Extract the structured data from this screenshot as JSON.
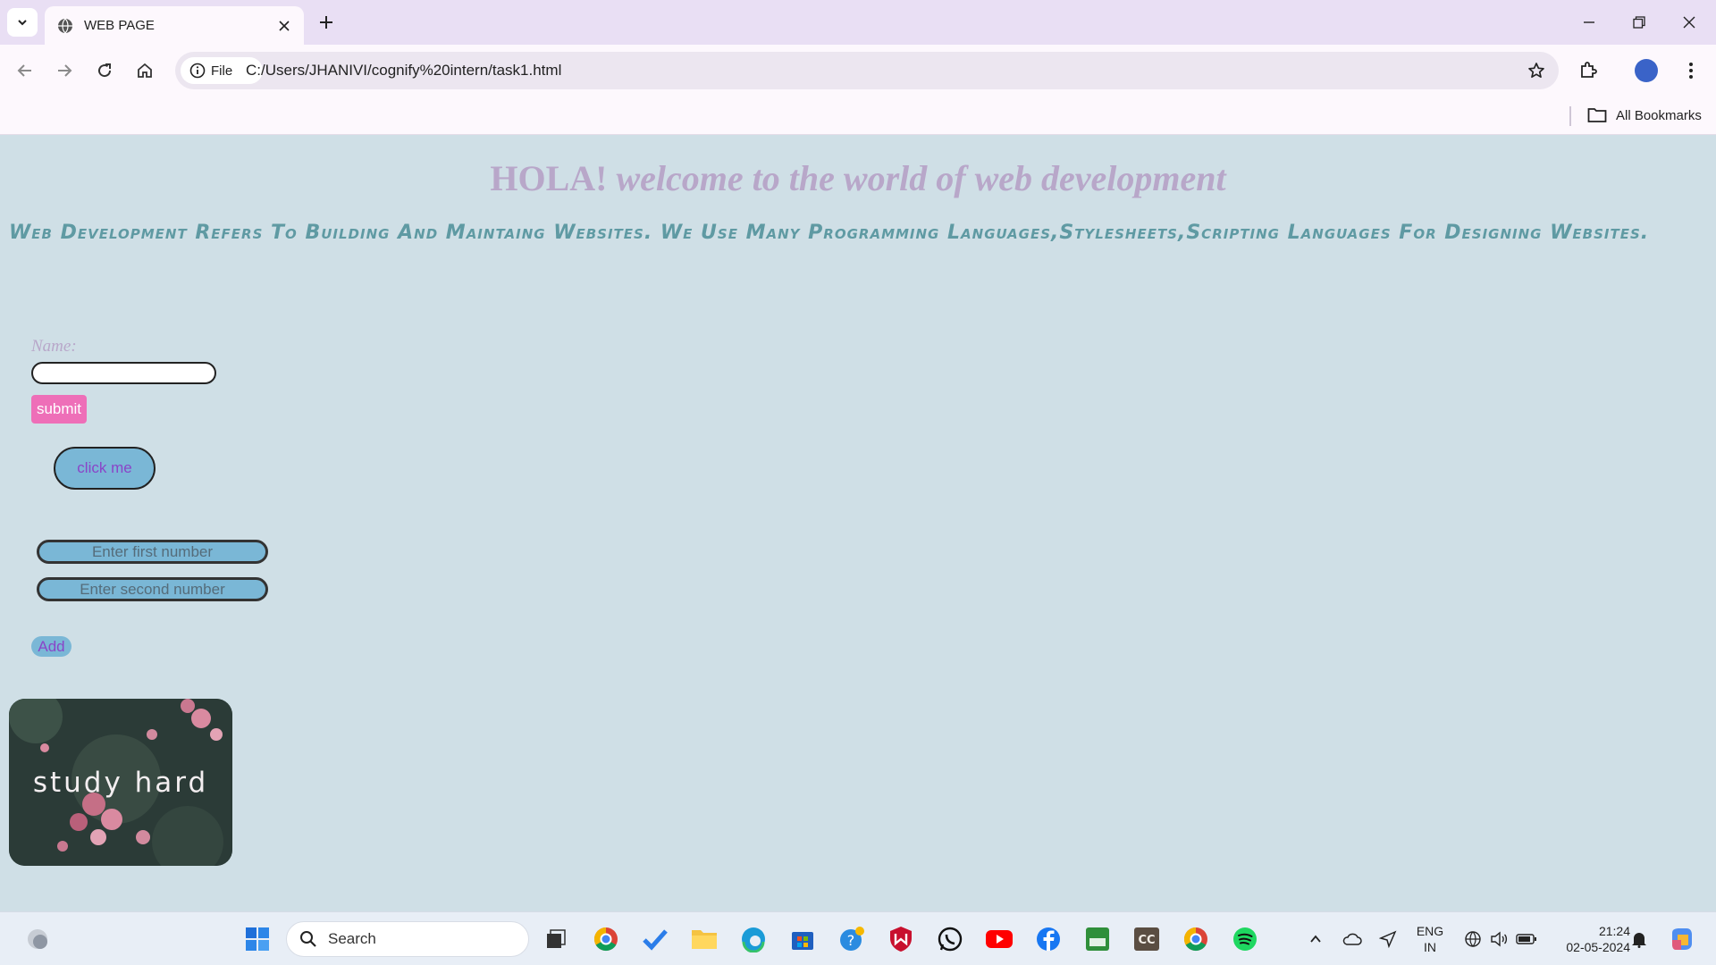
{
  "browser": {
    "tab_title": "WEB PAGE",
    "site_info_label": "File",
    "url": "C:/Users/JHANIVI/cognify%20intern/task1.html",
    "all_bookmarks_label": "All Bookmarks"
  },
  "page": {
    "heading_plain": "HOLA!",
    "heading_italic": "welcome to the world of web development",
    "intro": "Web Development Refers To Building And Maintaing Websites. We Use Many Programming Languages,Stylesheets,Scripting Languages For Designing Websites.",
    "name_label": "Name:",
    "submit_label": "submit",
    "click_label": "click me",
    "first_placeholder": "Enter first number",
    "second_placeholder": "Enter second number",
    "add_label": "Add",
    "image_caption": "study hard"
  },
  "taskbar": {
    "search_label": "Search",
    "lang_top": "ENG",
    "lang_bottom": "IN",
    "time": "21:24",
    "date": "02-05-2024"
  },
  "colors": {
    "page_bg": "#cfdfe6",
    "heading": "#b8a7c9",
    "intro_text": "#5f9aa3",
    "submit_bg": "#ee6fb8",
    "button_bg": "#7ab7d6",
    "button_text": "#8a45c8"
  },
  "icons": [
    "globe-icon",
    "close-icon",
    "plus-icon",
    "back-icon",
    "forward-icon",
    "reload-icon",
    "home-icon",
    "info-icon",
    "star-icon",
    "extensions-icon",
    "menu-icon",
    "folder-icon",
    "windows-icon",
    "search-icon"
  ]
}
